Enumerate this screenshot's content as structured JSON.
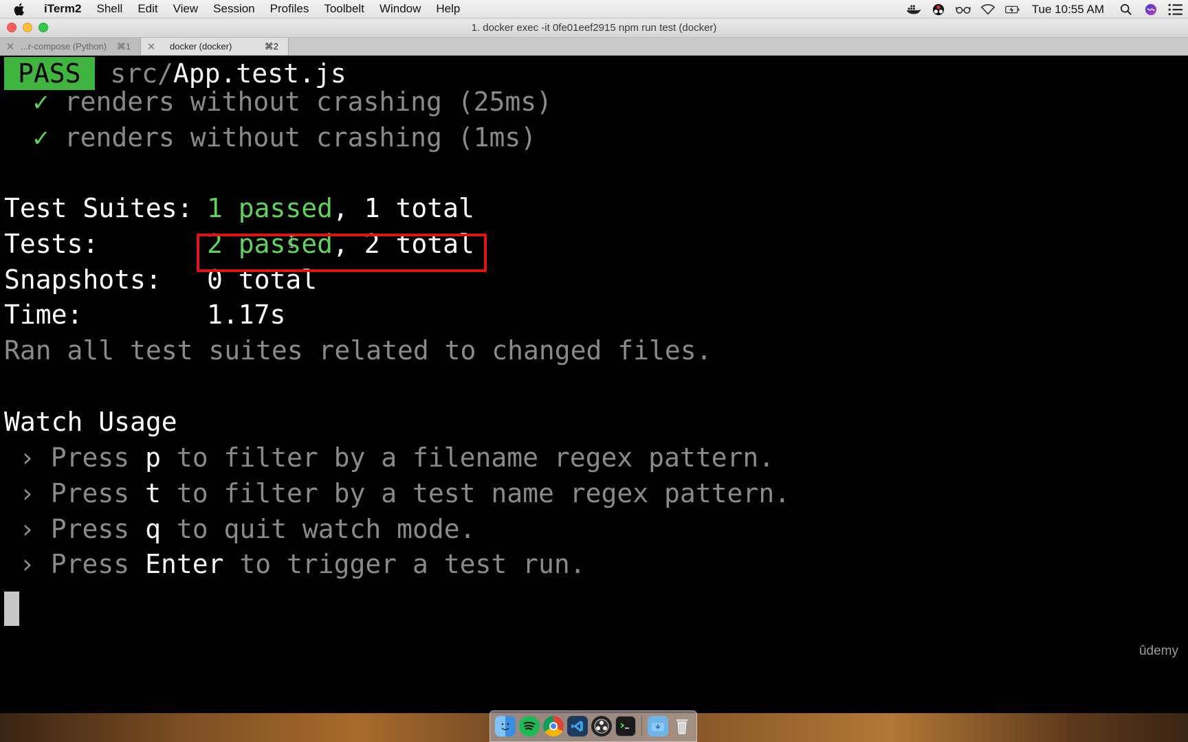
{
  "menubar": {
    "app": "iTerm2",
    "items": [
      "Shell",
      "Edit",
      "View",
      "Session",
      "Profiles",
      "Toolbelt",
      "Window",
      "Help"
    ],
    "clock": "Tue 10:55 AM"
  },
  "window": {
    "title": "1. docker exec -it 0fe01eef2915 npm run test (docker)"
  },
  "tabs": [
    {
      "title": "...r-compose (Python)",
      "shortcut": "⌘1"
    },
    {
      "title": "docker (docker)",
      "shortcut": "⌘2"
    }
  ],
  "terminal": {
    "pass_badge": "PASS",
    "file_prefix": "src/",
    "file_name": "App.test.js",
    "tests": [
      {
        "check": "✓",
        "text": "renders without crashing (25ms)"
      },
      {
        "check": "✓",
        "text": "renders without crashing (1ms)"
      }
    ],
    "summary": {
      "suites_label": "Test Suites:",
      "suites_passed": "1 passed",
      "suites_total": ", 1 total",
      "tests_label": "Tests:",
      "tests_passed": "2 passed",
      "tests_total": ", 2 total",
      "snapshots_label": "Snapshots:",
      "snapshots_value": "0 total",
      "time_label": "Time:",
      "time_value": "1.17s",
      "ran_all": "Ran all test suites related to changed files."
    },
    "watch": {
      "heading": "Watch Usage",
      "items": [
        {
          "arrow": "›",
          "pre": "Press ",
          "key": "p",
          "post": " to filter by a filename regex pattern."
        },
        {
          "arrow": "›",
          "pre": "Press ",
          "key": "t",
          "post": " to filter by a test name regex pattern."
        },
        {
          "arrow": "›",
          "pre": "Press ",
          "key": "q",
          "post": " to quit watch mode."
        },
        {
          "arrow": "›",
          "pre": "Press ",
          "key": "Enter",
          "post": " to trigger a test run."
        }
      ]
    },
    "watermark": "ûdemy"
  },
  "dock": {
    "icons": [
      "finder-icon",
      "spotify-icon",
      "chrome-icon",
      "vscode-icon",
      "obs-icon",
      "terminal-icon",
      "downloads-folder-icon",
      "trash-icon"
    ]
  },
  "colors": {
    "pass_badge_bg": "#3fb53f",
    "passed_green": "#5fd35f",
    "highlight_red": "#e11414"
  }
}
